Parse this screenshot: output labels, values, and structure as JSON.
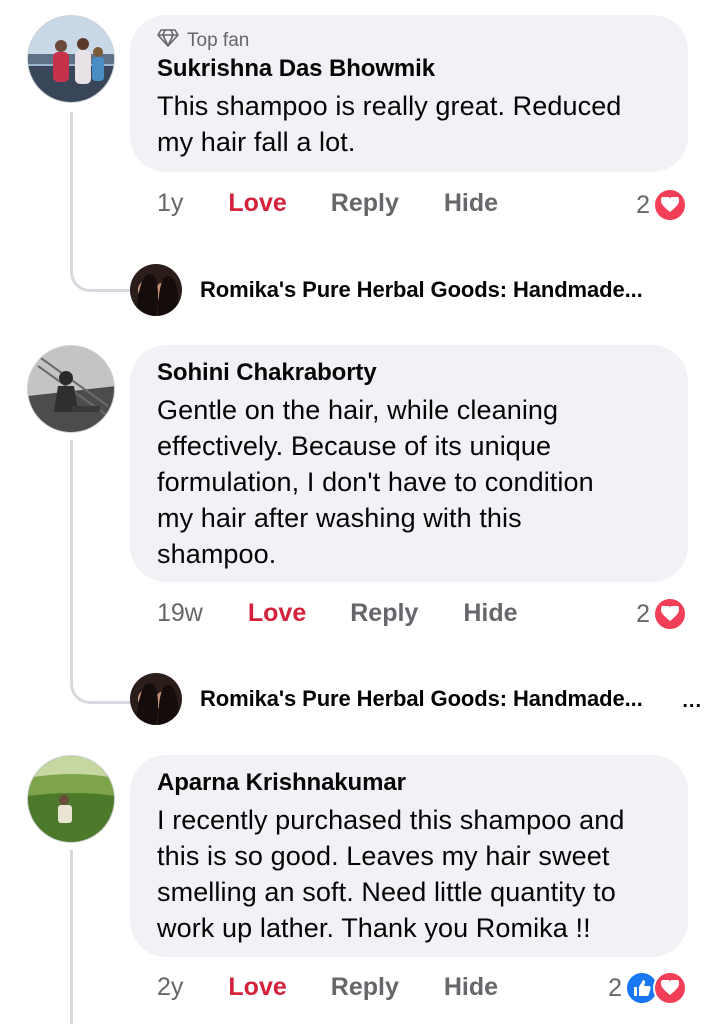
{
  "comments": [
    {
      "badge": "Top fan",
      "author": "Sukrishna Das Bhowmik",
      "lines": [
        "This shampoo is really great. Reduced",
        "my hair fall a lot."
      ],
      "time": "1y",
      "love": "Love",
      "reply": "Reply",
      "hide": "Hide",
      "reaction_count": "2",
      "reactions": [
        "heart-icon"
      ],
      "reply_preview": "Romika's Pure Herbal Goods: Handmade..."
    },
    {
      "author": "Sohini Chakraborty",
      "lines": [
        "Gentle on the hair, while cleaning",
        "effectively. Because of its unique",
        "formulation, I don't have to condition",
        "my hair after washing with this",
        "shampoo."
      ],
      "time": "19w",
      "love": "Love",
      "reply": "Reply",
      "hide": "Hide",
      "reaction_count": "2",
      "reactions": [
        "heart-icon"
      ],
      "reply_preview": "Romika's Pure Herbal Goods: Handmade...",
      "more": "..."
    },
    {
      "author": "Aparna Krishnakumar",
      "lines": [
        "I recently purchased this shampoo and",
        "this is so good. Leaves my hair sweet",
        "smelling an soft. Need little quantity to",
        "work up lather. Thank you Romika !!"
      ],
      "time": "2y",
      "love": "Love",
      "reply": "Reply",
      "hide": "Hide",
      "reaction_count": "2",
      "reactions": [
        "like-icon",
        "heart-icon"
      ]
    }
  ],
  "colors": {
    "love": "#d4213c",
    "bubble": "#f0f2f5",
    "heart": "#f33e58",
    "like": "#1877f2"
  }
}
